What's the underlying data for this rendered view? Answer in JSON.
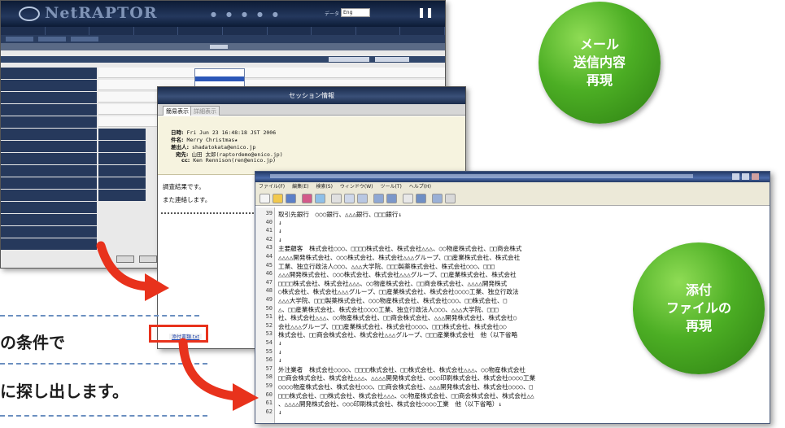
{
  "window_main": {
    "title": "NetRAPTOR",
    "lang_label": "データ",
    "lang_value": "Eng"
  },
  "window_session": {
    "title": "セッション情報",
    "tabs": [
      "簡易表示",
      "詳細表示"
    ],
    "headers": {
      "date_label": "日時:",
      "date_value": "Fri Jun 23 16:48:18 JST 2006",
      "subject_label": "件名:",
      "subject_value": "Merry Christmas★",
      "from_label": "差出人:",
      "from_value": "shadatokata@enico.jp",
      "to_label": "宛先:",
      "to_value": "山田 太郎(raptordemo@enico.jp)",
      "cc_label": "cc:",
      "cc_value": "Ken Rennison(ren@enico.jp)"
    },
    "body_lines": [
      "調査結果です。",
      "また連絡します。"
    ],
    "attachment_label": "添付書類.txt"
  },
  "window_viewer": {
    "menu": [
      "ファイル(F)",
      "編集(E)",
      "検索(S)",
      "ウィンドウ(W)",
      "ツール(T)",
      "ヘルプ(H)"
    ],
    "lines": [
      {
        "n": "39",
        "t": "取引先銀行　○○○銀行、△△△銀行、□□□銀行↓"
      },
      {
        "n": "40",
        "t": "↓"
      },
      {
        "n": "41",
        "t": "↓"
      },
      {
        "n": "42",
        "t": "↓"
      },
      {
        "n": "43",
        "t": "主要顧客　株式会社○○○、□□□□株式会社、株式会社△△△、○○物産株式会社、□□商会株式"
      },
      {
        "n": "44",
        "t": "△△△△開発株式会社、○○○株式会社、株式会社△△△グループ、□□産業株式会社、株式会社"
      },
      {
        "n": "45",
        "t": "工業、独立行政法人○○○、△△△大学院、□□□製薬株式会社、株式会社○○○、□□□"
      },
      {
        "n": "46",
        "t": "△△△開発株式会社、○○○株式会社、株式会社△△△グループ、□□産業株式会社、株式会社"
      },
      {
        "n": "47",
        "t": "□□□□株式会社、株式会社△△△、○○物産株式会社、□□商会株式会社、△△△△開発株式"
      },
      {
        "n": "48",
        "t": "○株式会社、株式会社△△△グループ、□□産業株式会社、株式会社○○○○工業、独立行政法"
      },
      {
        "n": "49",
        "t": "△△△大学院、□□□製薬株式会社、○○○物産株式会社、株式会社○○○、□□株式会社、□"
      },
      {
        "n": "50",
        "t": "△、□□産業株式会社、株式会社○○○○工業、独立行政法人○○○、△△△大学院、□□□"
      },
      {
        "n": "51",
        "t": "社、株式会社△△△、○○物産株式会社、□□商会株式会社、△△△開発株式会社、株式会社○"
      },
      {
        "n": "52",
        "t": "会社△△△グループ、□□□産業株式会社、株式会社○○○○、□□□株式会社、株式会社○○"
      },
      {
        "n": "53",
        "t": "株式会社、□□商会株式会社、株式会社△△△グループ、□□□産業株式会社　他（以下省略"
      },
      {
        "n": "54",
        "t": "↓"
      },
      {
        "n": "55",
        "t": "↓"
      },
      {
        "n": "56",
        "t": "↓"
      },
      {
        "n": "57",
        "t": "外注業者　株式会社○○○○、□□□□株式会社、□□株式会社、株式会社△△△、○○物産株式会社"
      },
      {
        "n": "58",
        "t": "□□商会株式会社、株式会社△△△、△△△△開発株式会社、○○○印刷株式会社、株式会社○○○○工業"
      },
      {
        "n": "59",
        "t": "○○○○物産株式会社、株式会社○○○、□□商会株式会社、△△△開発株式会社、株式会社○○○○、□"
      },
      {
        "n": "60",
        "t": "□□□株式会社、□□株式会社、株式会社△△△、○○物産株式会社、□□商会株式会社、株式会社△△"
      },
      {
        "n": "61",
        "t": "、△△△△開発株式会社、○○○印刷株式会社、株式会社○○○○工業　他（以下省略）↓"
      },
      {
        "n": "62",
        "t": "↓"
      }
    ]
  },
  "bubbles": {
    "top": [
      "メール",
      "送信内容",
      "再現"
    ],
    "bottom": [
      "添付",
      "ファイルの",
      "再現"
    ]
  },
  "caption": {
    "line1": "の条件で",
    "line2": "に探し出します。"
  },
  "colors": {
    "bubble_green": "#4cae24",
    "arrow_red": "#e8321c",
    "dash_blue": "#6b8fc0"
  }
}
